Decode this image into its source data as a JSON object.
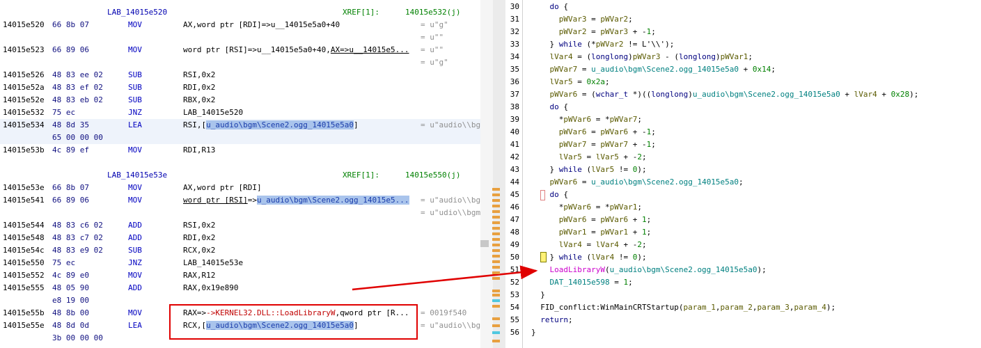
{
  "listing": {
    "label1": "LAB_14015e520",
    "xref1_label": "XREF[1]:",
    "xref1_target": "14015e532(j)",
    "label2": "LAB_14015e53e",
    "xref2_label": "XREF[1]:",
    "xref2_target": "14015e550(j)",
    "rows": [
      {
        "addr": "14015e520",
        "bytes": "66 8b 07",
        "mn": "MOV",
        "op": "AX,word ptr [RDI]=>u__14015e5a0+40",
        "cmt": "= u\"g\""
      },
      {
        "addr": "",
        "bytes": "",
        "mn": "",
        "op": "",
        "cmt": "= u\"\""
      },
      {
        "addr": "14015e523",
        "bytes": "66 89 06",
        "mn": "MOV",
        "op": "word ptr [RSI]=>u__14015e5a0+40,AX=>u__14015e5...",
        "cmt": "= u\"\""
      },
      {
        "addr": "",
        "bytes": "",
        "mn": "",
        "op": "",
        "cmt": "= u\"g\""
      },
      {
        "addr": "14015e526",
        "bytes": "48 83 ee 02",
        "mn": "SUB",
        "op": "RSI,0x2",
        "cmt": ""
      },
      {
        "addr": "14015e52a",
        "bytes": "48 83 ef 02",
        "mn": "SUB",
        "op": "RDI,0x2",
        "cmt": ""
      },
      {
        "addr": "14015e52e",
        "bytes": "48 83 eb 02",
        "mn": "SUB",
        "op": "RBX,0x2",
        "cmt": ""
      },
      {
        "addr": "14015e532",
        "bytes": "75 ec",
        "mn": "JNZ",
        "op": "LAB_14015e520",
        "cmt": ""
      },
      {
        "addr": "14015e534",
        "bytes": "48 8d 35",
        "mn": "LEA",
        "op": "RSI,[u_audio\\bgm\\Scene2.ogg_14015e5a0]",
        "cmt": "= u\"audio\\\\bgm"
      },
      {
        "addr": "",
        "bytes": "65 00 00 00",
        "mn": "",
        "op": "",
        "cmt": ""
      },
      {
        "addr": "14015e53b",
        "bytes": "4c 89 ef",
        "mn": "MOV",
        "op": "RDI,R13",
        "cmt": ""
      },
      {
        "addr": "14015e53e",
        "bytes": "66 8b 07",
        "mn": "MOV",
        "op": "AX,word ptr [RDI]",
        "cmt": ""
      },
      {
        "addr": "14015e541",
        "bytes": "66 89 06",
        "mn": "MOV",
        "op": "word ptr [RSI]=>u_audio\\bgm\\Scene2.ogg_14015e5...",
        "cmt": "= u\"audio\\\\bgm"
      },
      {
        "addr": "",
        "bytes": "",
        "mn": "",
        "op": "",
        "cmt": "= u\"udio\\\\bgm"
      },
      {
        "addr": "14015e544",
        "bytes": "48 83 c6 02",
        "mn": "ADD",
        "op": "RSI,0x2",
        "cmt": ""
      },
      {
        "addr": "14015e548",
        "bytes": "48 83 c7 02",
        "mn": "ADD",
        "op": "RDI,0x2",
        "cmt": ""
      },
      {
        "addr": "14015e54c",
        "bytes": "48 83 e9 02",
        "mn": "SUB",
        "op": "RCX,0x2",
        "cmt": ""
      },
      {
        "addr": "14015e550",
        "bytes": "75 ec",
        "mn": "JNZ",
        "op": "LAB_14015e53e",
        "cmt": ""
      },
      {
        "addr": "14015e552",
        "bytes": "4c 89 e0",
        "mn": "MOV",
        "op": "RAX,R12",
        "cmt": ""
      },
      {
        "addr": "14015e555",
        "bytes": "48 05 90",
        "mn": "ADD",
        "op": "RAX,0x19e890",
        "cmt": ""
      },
      {
        "addr": "",
        "bytes": "e8 19 00",
        "mn": "",
        "op": "",
        "cmt": ""
      },
      {
        "addr": "14015e55b",
        "bytes": "48 8b 00",
        "mn": "MOV",
        "op": "RAX=>->KERNEL32.DLL::LoadLibraryW,qword ptr [R...",
        "cmt": "= 0019f540"
      },
      {
        "addr": "14015e55e",
        "bytes": "48 8d 0d",
        "mn": "LEA",
        "op": "RCX,[u_audio\\bgm\\Scene2.ogg_14015e5a0]",
        "cmt": "= u\"audio\\\\bgm"
      },
      {
        "addr": "",
        "bytes": "3b 00 00 00",
        "mn": "",
        "op": "",
        "cmt": ""
      }
    ]
  },
  "decompiler": {
    "lines": [
      {
        "n": "30",
        "t": "    do {"
      },
      {
        "n": "31",
        "t": "      pWVar3 = pWVar2;"
      },
      {
        "n": "32",
        "t": "      pWVar2 = pWVar3 + -1;"
      },
      {
        "n": "33",
        "t": "    } while (*pWVar2 != L'\\\\');"
      },
      {
        "n": "34",
        "t": "    lVar4 = (longlong)pWVar3 - (longlong)pWVar1;"
      },
      {
        "n": "35",
        "t": "    pWVar7 = u_audio\\bgm\\Scene2.ogg_14015e5a0 + 0x14;"
      },
      {
        "n": "36",
        "t": "    lVar5 = 0x2a;"
      },
      {
        "n": "37",
        "t": "    pWVar6 = (wchar_t *)((longlong)u_audio\\bgm\\Scene2.ogg_14015e5a0 + lVar4 + 0x28);"
      },
      {
        "n": "38",
        "t": "    do {"
      },
      {
        "n": "39",
        "t": "      *pWVar6 = *pWVar7;"
      },
      {
        "n": "40",
        "t": "      pWVar6 = pWVar6 + -1;"
      },
      {
        "n": "41",
        "t": "      pWVar7 = pWVar7 + -1;"
      },
      {
        "n": "42",
        "t": "      lVar5 = lVar5 + -2;"
      },
      {
        "n": "43",
        "t": "    } while (lVar5 != 0);"
      },
      {
        "n": "44",
        "t": "    pWVar6 = u_audio\\bgm\\Scene2.ogg_14015e5a0;"
      },
      {
        "n": "45",
        "t": "    do {"
      },
      {
        "n": "46",
        "t": "      *pWVar6 = *pWVar1;"
      },
      {
        "n": "47",
        "t": "      pWVar6 = pWVar6 + 1;"
      },
      {
        "n": "48",
        "t": "      pWVar1 = pWVar1 + 1;"
      },
      {
        "n": "49",
        "t": "      lVar4 = lVar4 + -2;"
      },
      {
        "n": "50",
        "t": "    } while (lVar4 != 0);"
      },
      {
        "n": "51",
        "t": "    LoadLibraryW(u_audio\\bgm\\Scene2.ogg_14015e5a0);"
      },
      {
        "n": "52",
        "t": "    DAT_14015e598 = 1;"
      },
      {
        "n": "53",
        "t": "  }"
      },
      {
        "n": "54",
        "t": "  FID_conflict:WinMainCRTStartup(param_1,param_2,param_3,param_4);"
      },
      {
        "n": "55",
        "t": "  return;"
      },
      {
        "n": "56",
        "t": "}"
      }
    ]
  },
  "colors": {
    "highlight_box": "#e00000",
    "arrow": "#e00000",
    "selection": "#a9c4ec"
  }
}
